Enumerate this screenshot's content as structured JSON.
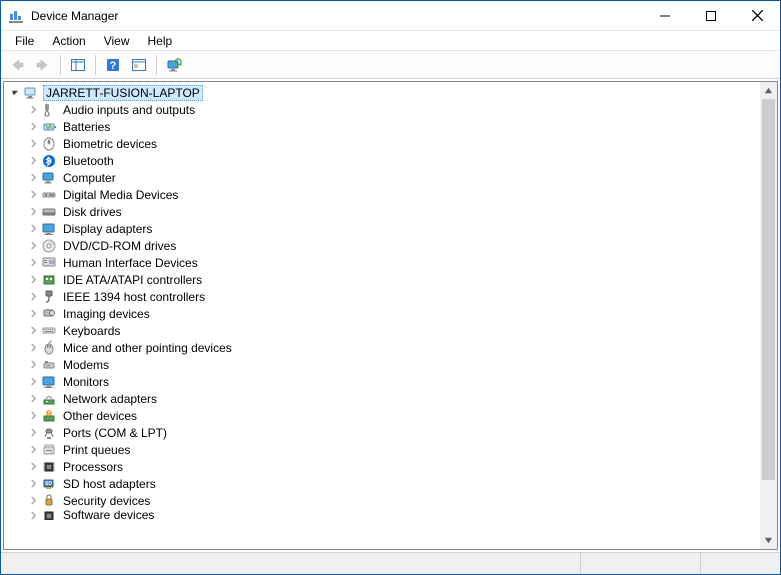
{
  "window": {
    "title": "Device Manager"
  },
  "menu": {
    "file": "File",
    "action": "Action",
    "view": "View",
    "help": "Help"
  },
  "tree": {
    "root": "JARRETT-FUSION-LAPTOP",
    "categories": [
      {
        "label": "Audio inputs and outputs"
      },
      {
        "label": "Batteries"
      },
      {
        "label": "Biometric devices"
      },
      {
        "label": "Bluetooth"
      },
      {
        "label": "Computer"
      },
      {
        "label": "Digital Media Devices"
      },
      {
        "label": "Disk drives"
      },
      {
        "label": "Display adapters"
      },
      {
        "label": "DVD/CD-ROM drives"
      },
      {
        "label": "Human Interface Devices"
      },
      {
        "label": "IDE ATA/ATAPI controllers"
      },
      {
        "label": "IEEE 1394 host controllers"
      },
      {
        "label": "Imaging devices"
      },
      {
        "label": "Keyboards"
      },
      {
        "label": "Mice and other pointing devices"
      },
      {
        "label": "Modems"
      },
      {
        "label": "Monitors"
      },
      {
        "label": "Network adapters"
      },
      {
        "label": "Other devices"
      },
      {
        "label": "Ports (COM & LPT)"
      },
      {
        "label": "Print queues"
      },
      {
        "label": "Processors"
      },
      {
        "label": "SD host adapters"
      },
      {
        "label": "Security devices"
      },
      {
        "label": "Software devices"
      }
    ]
  },
  "scrollbar": {
    "thumb_height_pct": 88
  }
}
